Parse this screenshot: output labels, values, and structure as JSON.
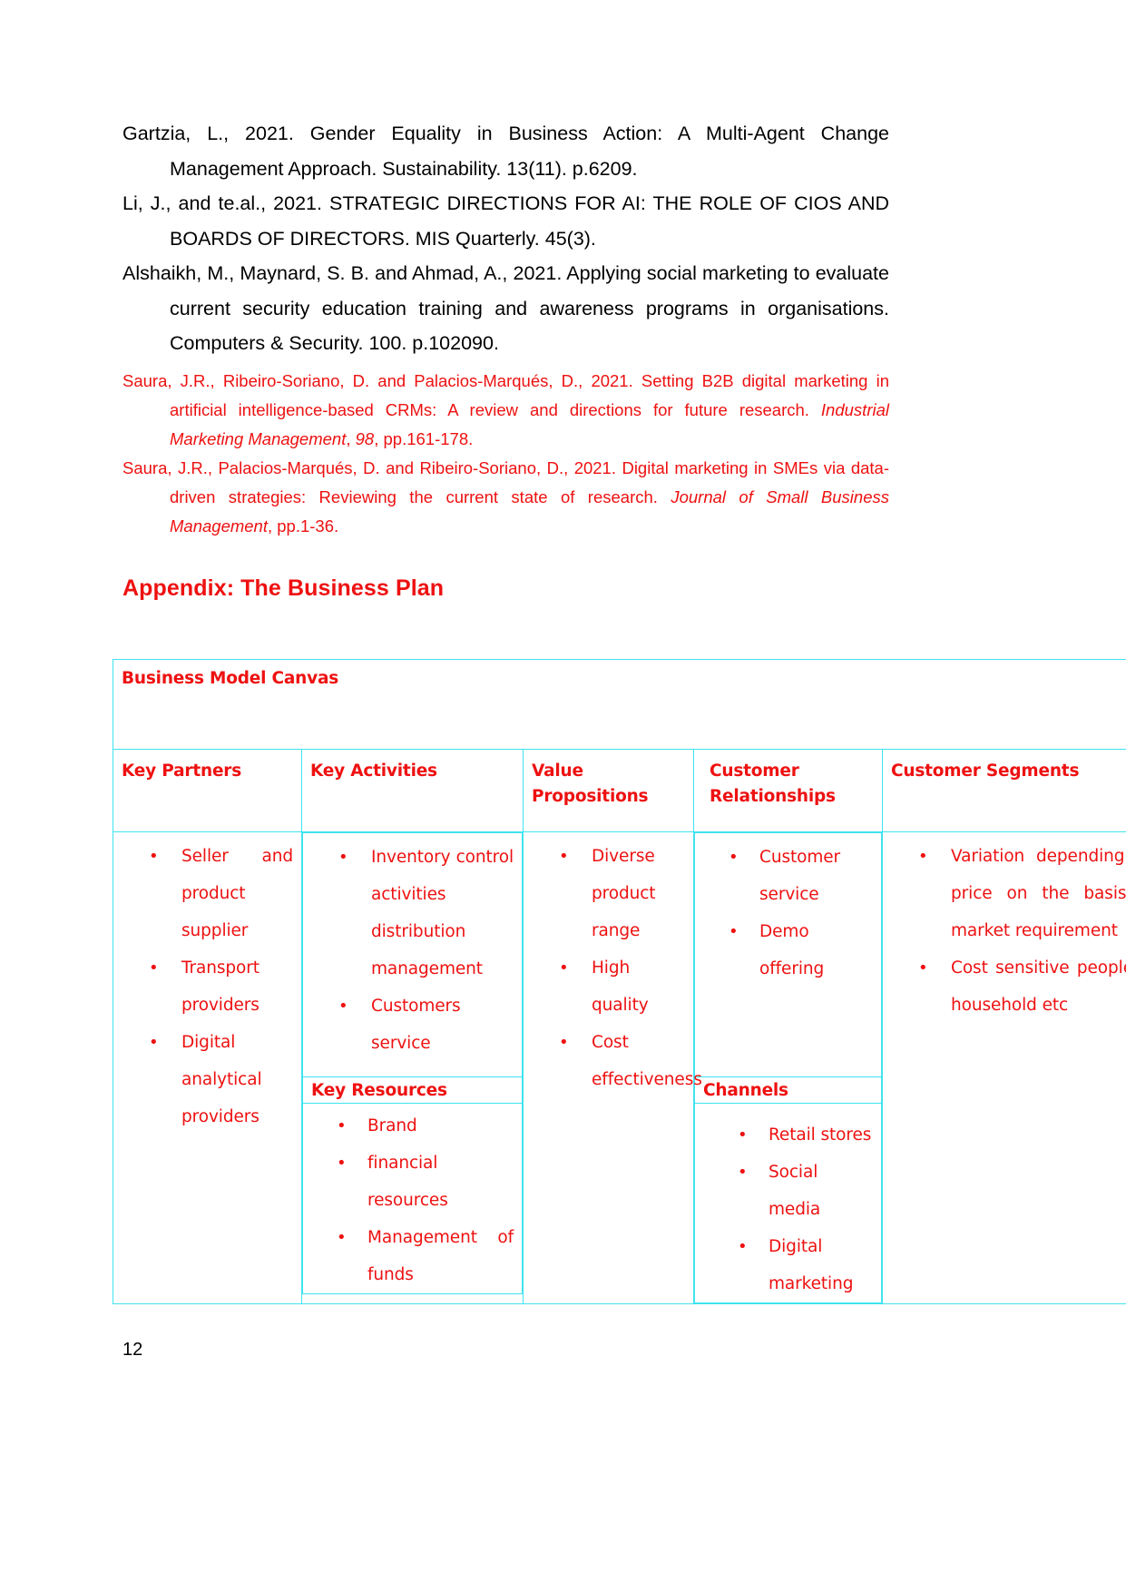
{
  "document": {
    "page_number": "12",
    "references_black": [
      "Gartzia, L., 2021. Gender Equality in Business Action: A Multi-Agent Change Management Approach. Sustainability. 13(11). p.6209.",
      "Li, J., and te.al.,  2021. STRATEGIC DIRECTIONS FOR AI: THE ROLE OF CIOS AND BOARDS OF DIRECTORS. MIS Quarterly. 45(3).",
      "Alshaikh, M., Maynard, S. B. and Ahmad, A., 2021. Applying social marketing to evaluate current security education training and awareness programs in organisations. Computers & Security. 100. p.102090."
    ],
    "references_red": [
      {
        "plain1": "Saura, J.R., Ribeiro-Soriano, D. and Palacios-Marqués, D., 2021. Setting B2B digital marketing in artificial intelligence-based CRMs: A review and directions for future research. ",
        "italic1": "Industrial Marketing Management",
        "plain2": ", ",
        "italic2": "98",
        "plain3": ", pp.161-178."
      },
      {
        "plain1": "Saura, J.R., Palacios-Marqués, D. and Ribeiro-Soriano, D., 2021. Digital marketing in SMEs via data-driven strategies: Reviewing the current state of research. ",
        "italic1": "Journal of Small Business Management",
        "plain2": "",
        "italic2": "",
        "plain3": ", pp.1-36."
      }
    ],
    "appendix_heading": "Appendix: The Business Plan",
    "canvas": {
      "title": "Business Model Canvas",
      "columns": [
        {
          "header": "Key Partners"
        },
        {
          "header": "Key Activities"
        },
        {
          "header": "Value Propositions"
        },
        {
          "header": "Customer  Relationships"
        },
        {
          "header": "Customer Segments"
        }
      ],
      "key_partners": [
        "Seller and product supplier",
        "Transport providers",
        "Digital analytical providers"
      ],
      "key_activities": [
        "Inventory control activities distribution management",
        "Customers service"
      ],
      "key_resources_header": "Key Resources",
      "key_resources": [
        "Brand",
        "financial resources",
        "Management of funds"
      ],
      "value_propositions": [
        "Diverse product range",
        "High quality",
        "Cost effectiveness"
      ],
      "customer_relationships": [
        "Customer service",
        "Demo offering"
      ],
      "channels_header": "Channels",
      "channels": [
        "Retail stores",
        "Social media",
        "Digital marketing"
      ],
      "customer_segments": [
        "Variation depending on price on the basis of market requirement",
        "Cost sensitive people of household etc"
      ]
    }
  },
  "colors": {
    "red_text": "#ee1111",
    "table_border": "#3fe3ef",
    "black_text": "#000000"
  }
}
